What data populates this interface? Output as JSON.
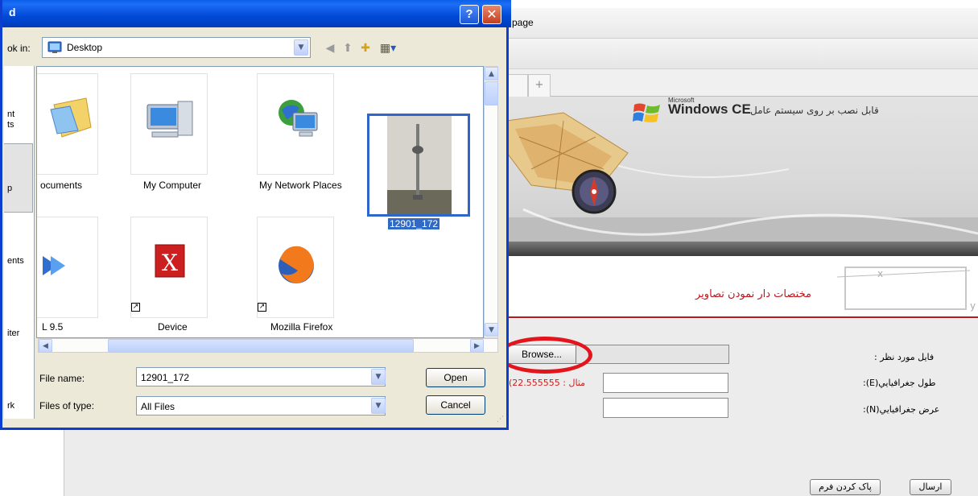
{
  "browser": {
    "page_title": "page",
    "new_tab_symbol": "+",
    "banner": {
      "microsoft_label": "Microsoft",
      "product_name": "Windows CE",
      "install_text": "قابل نصب بر روی سیستم عامل"
    },
    "section_title": "مختصات دار نمودن تصاویر",
    "form": {
      "file_label": "فایل مورد نظر :",
      "longitude_label": "طول جغرافيايي(E):",
      "latitude_label": "عرض جغرافيايي(N):",
      "browse_label": "Browse...",
      "longitude_hint": "(مثال : 22.555555",
      "longitude_value": "",
      "latitude_value": "",
      "submit_label": "ارسال",
      "reset_label": "پاک کردن فرم"
    }
  },
  "dialog": {
    "title": "d",
    "help_symbol": "?",
    "close_symbol": "✕",
    "look_in_label": "ok in:",
    "look_in_value": "Desktop",
    "places": [
      {
        "label": "nt\nts"
      },
      {
        "label": "p"
      },
      {
        "label": "ents"
      },
      {
        "label": "iter"
      },
      {
        "label": "rk"
      }
    ],
    "files": [
      {
        "label": "ocuments",
        "icon": "my-documents-icon"
      },
      {
        "label": "My Computer",
        "icon": "my-computer-icon"
      },
      {
        "label": "My Network Places",
        "icon": "network-places-icon"
      },
      {
        "label": "12901_172",
        "icon": "image-thumbnail",
        "selected": true
      },
      {
        "label": "L 9.5",
        "icon": "media-player-icon"
      },
      {
        "label": "Device",
        "icon": "device-icon"
      },
      {
        "label": "Mozilla Firefox",
        "icon": "firefox-icon"
      }
    ],
    "file_name_label": "File name:",
    "file_name_value": "12901_172",
    "files_of_type_label": "Files of type:",
    "files_of_type_value": "All Files",
    "open_label": "Open",
    "cancel_label": "Cancel"
  }
}
